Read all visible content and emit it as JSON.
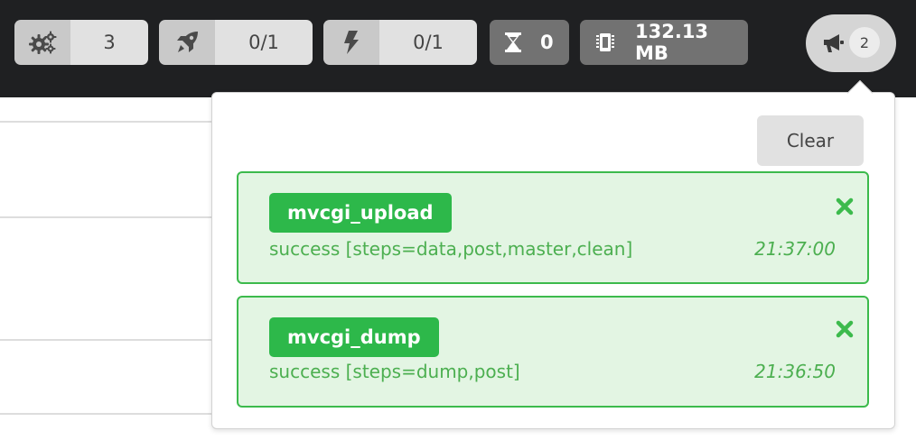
{
  "toolbar": {
    "workers": {
      "icon": "gears-icon",
      "value": "3"
    },
    "launch": {
      "icon": "rocket-icon",
      "value": "0/1"
    },
    "power": {
      "icon": "bolt-icon",
      "value": "0/1"
    },
    "queue": {
      "icon": "hourglass-icon",
      "value": "0"
    },
    "memory": {
      "icon": "memory-chip-icon",
      "value": "132.13 MB"
    },
    "notifications": {
      "icon": "megaphone-icon",
      "count": "2"
    }
  },
  "panel": {
    "clear_label": "Clear",
    "notifications": [
      {
        "name": "mvcgi_upload",
        "message": "success [steps=data,post,master,clean]",
        "time": "21:37:00",
        "close_icon": "close-x-icon"
      },
      {
        "name": "mvcgi_dump",
        "message": "success [steps=dump,post]",
        "time": "21:36:50",
        "close_icon": "close-x-icon"
      }
    ]
  },
  "colors": {
    "topbar": "#1f2022",
    "success_border": "#3cba4c",
    "success_bg": "#e3f5e3",
    "success_tag": "#2db84a",
    "success_text": "#4caf50"
  }
}
